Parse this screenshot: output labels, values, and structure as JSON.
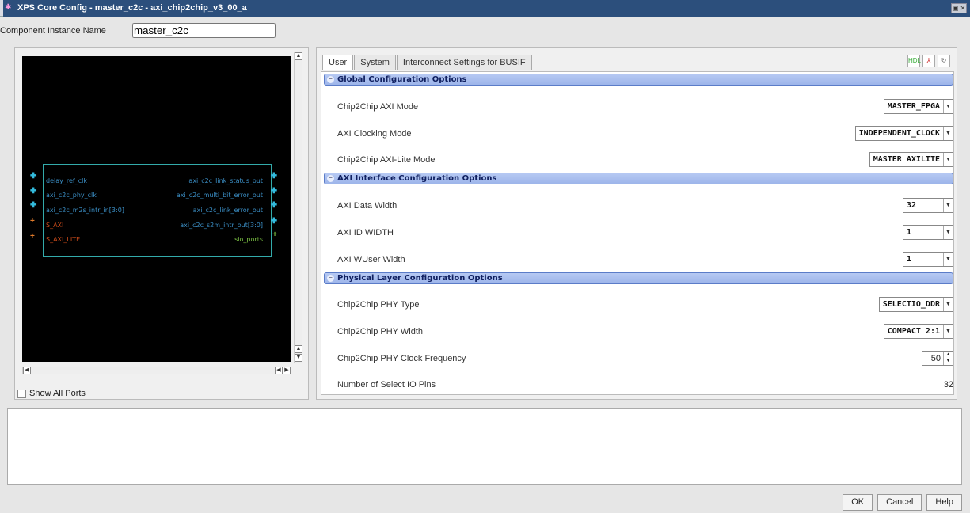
{
  "window": {
    "title": "XPS Core Config - master_c2c - axi_chip2chip_v3_00_a",
    "close_label": "▣ ✕"
  },
  "instance": {
    "label": "Component Instance Name",
    "value": "master_c2c"
  },
  "block": {
    "left_ports": [
      "delay_ref_clk",
      "axi_c2c_phy_clk",
      "axi_c2c_m2s_intr_in[3:0]",
      "S_AXI",
      "S_AXI_LITE"
    ],
    "right_ports": [
      "axi_c2c_link_status_out",
      "axi_c2c_multi_bit_error_out",
      "axi_c2c_link_error_out",
      "axi_c2c_s2m_intr_out[3:0]",
      "sio_ports"
    ],
    "colors": {
      "port_text": "#3b8fc6",
      "bus_text": "#c84a1a",
      "sio_text": "#7bc143",
      "box": "#33aaaa"
    }
  },
  "show_all_ports": {
    "label": "Show All Ports",
    "checked": false
  },
  "tabs": [
    "User",
    "System",
    "Interconnect Settings for BUSIF"
  ],
  "tab_icons": [
    "hdl-icon",
    "pdf-icon",
    "refresh-icon"
  ],
  "sections": [
    {
      "title": "Global Configuration Options",
      "params": [
        {
          "label": "Chip2Chip AXI Mode",
          "value": "MASTER_FPGA",
          "control": "combo"
        },
        {
          "label": "AXI Clocking Mode",
          "value": "INDEPENDENT_CLOCK",
          "control": "combo"
        },
        {
          "label": "Chip2Chip AXI-Lite Mode",
          "value": "MASTER AXILITE",
          "control": "combo"
        }
      ]
    },
    {
      "title": "AXI Interface Configuration Options",
      "params": [
        {
          "label": "AXI Data Width",
          "value": "32",
          "control": "combo"
        },
        {
          "label": "AXI ID WIDTH",
          "value": "1",
          "control": "combo"
        },
        {
          "label": "AXI WUser Width",
          "value": "1",
          "control": "combo"
        }
      ]
    },
    {
      "title": "Physical Layer Configuration Options",
      "params": [
        {
          "label": "Chip2Chip PHY Type",
          "value": "SELECTIO_DDR",
          "control": "combo"
        },
        {
          "label": "Chip2Chip PHY Width",
          "value": "COMPACT 2:1",
          "control": "combo"
        },
        {
          "label": "Chip2Chip PHY Clock Frequency",
          "value": "50",
          "control": "spin"
        },
        {
          "label": "Number of Select IO Pins",
          "value": "32",
          "control": "readonly"
        }
      ]
    }
  ],
  "buttons": {
    "ok": "OK",
    "cancel": "Cancel",
    "help": "Help"
  },
  "accent": "#2c4f7c"
}
